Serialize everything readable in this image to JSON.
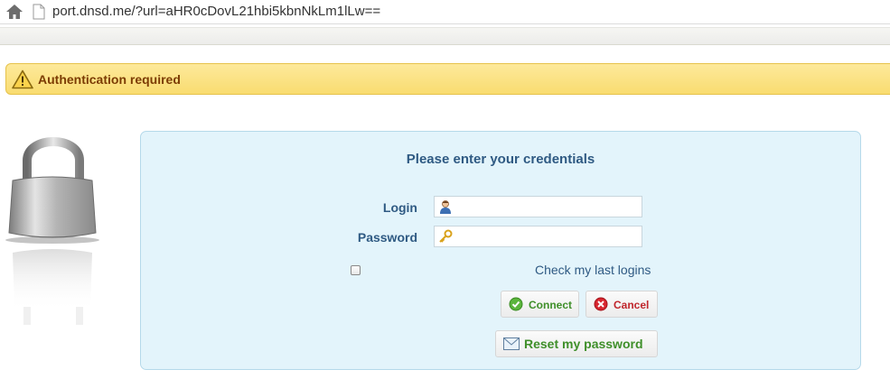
{
  "browser": {
    "url": "port.dnsd.me/?url=aHR0cDovL21hbi5kbnNkLm1lLw=="
  },
  "alert": {
    "message": "Authentication required"
  },
  "form": {
    "title": "Please enter your credentials",
    "login_label": "Login",
    "login_value": "",
    "password_label": "Password",
    "password_value": "",
    "remember_label": "Check my last logins",
    "connect_label": "Connect",
    "cancel_label": "Cancel",
    "reset_label": "Reset my password"
  },
  "colors": {
    "alert_bg": "#f9dc70",
    "alert_text": "#7c3c03",
    "panel_bg": "#e3f4fb",
    "label_text": "#2f5a83",
    "connect_text": "#3f8f2a",
    "cancel_text": "#c0262c"
  },
  "icons": {
    "home": "home-icon",
    "page": "page-icon",
    "alert": "warning-icon",
    "lock": "padlock-icon",
    "login": "user-icon",
    "password": "key-icon",
    "connect": "check-circle-icon",
    "cancel": "x-circle-icon",
    "reset": "envelope-icon"
  }
}
